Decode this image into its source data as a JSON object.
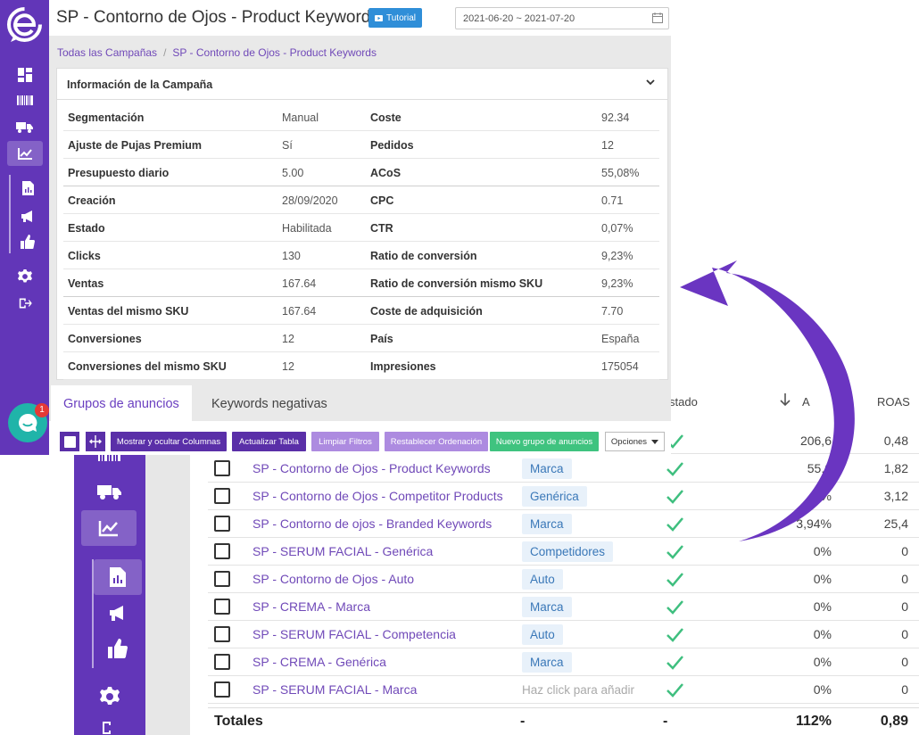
{
  "header": {
    "title": "SP - Contorno de Ojos - Product Keywords",
    "tutorial_label": "Tutorial",
    "date_range": "2021-06-20 ~ 2021-07-20"
  },
  "breadcrumb": {
    "root": "Todas las Campañas",
    "separator": "/",
    "current": "SP - Contorno de Ojos - Product Keywords"
  },
  "chat": {
    "badge_count": "1"
  },
  "campaign_info": {
    "title": "Información de la Campaña",
    "rows": [
      {
        "l1": "Segmentación",
        "v1": "Manual",
        "l2": "Coste",
        "v2": "92.34"
      },
      {
        "l1": "Ajuste de Pujas Premium",
        "v1": "Sí",
        "l2": "Pedidos",
        "v2": "12"
      },
      {
        "l1": "Presupuesto diario",
        "v1": "5.00",
        "l2": "ACoS",
        "v2": "55,08%"
      },
      {
        "l1": "Creación",
        "v1": "28/09/2020",
        "l2": "CPC",
        "v2": "0.71"
      },
      {
        "l1": "Estado",
        "v1": "Habilitada",
        "l2": "CTR",
        "v2": "0,07%"
      },
      {
        "l1": "Clicks",
        "v1": "130",
        "l2": "Ratio de conversión",
        "v2": "9,23%"
      },
      {
        "l1": "Ventas",
        "v1": "167.64",
        "l2": "Ratio de conversión mismo SKU",
        "v2": "9,23%"
      },
      {
        "l1": "Ventas del mismo SKU",
        "v1": "167.64",
        "l2": "Coste de adquisición",
        "v2": "7.70"
      },
      {
        "l1": "Conversiones",
        "v1": "12",
        "l2": "País",
        "v2": "España"
      },
      {
        "l1": "Conversiones del mismo SKU",
        "v1": "12",
        "l2": "Impresiones",
        "v2": "175054"
      }
    ]
  },
  "tabs": [
    "Grupos de anuncios",
    "Keywords negativas"
  ],
  "toolbar": {
    "show_hide_columns": "Mostrar y ocultar Columnas",
    "update_table": "Actualizar Tabla",
    "clear_filters": "Limpiar Filtros",
    "reset_order": "Restablecer Ordenación",
    "new_group": "Nuevo grupo de anuncios",
    "options": "Opciones"
  },
  "table": {
    "headers": {
      "estado": "stado",
      "acos_partial": "A",
      "roas": "ROAS"
    },
    "first_row": {
      "pct": "206,6",
      "roas": "0,48"
    },
    "rows": [
      {
        "name": "SP - Contorno de Ojos - Product Keywords",
        "tag": "Marca",
        "pct": "55,0",
        "roas": "1,82"
      },
      {
        "name": "SP - Contorno de Ojos - Competitor Products",
        "tag": "Genérica",
        "pct": "3  %",
        "roas": "3,12"
      },
      {
        "name": "SP - Contorno de ojos - Branded Keywords",
        "tag": "Marca",
        "pct": "3,94%",
        "roas": "25,4"
      },
      {
        "name": "SP - SERUM FACIAL - Genérica",
        "tag": "Competidores",
        "pct": "0%",
        "roas": "0"
      },
      {
        "name": "SP - Contorno de Ojos - Auto",
        "tag": "Auto",
        "pct": "0%",
        "roas": "0"
      },
      {
        "name": "SP - CREMA - Marca",
        "tag": "Marca",
        "pct": "0%",
        "roas": "0"
      },
      {
        "name": "SP - SERUM FACIAL - Competencia",
        "tag": "Auto",
        "pct": "0%",
        "roas": "0"
      },
      {
        "name": "SP - CREMA - Genérica",
        "tag": "Marca",
        "pct": "0%",
        "roas": "0"
      },
      {
        "name": "SP - SERUM FACIAL - Marca",
        "tag": "Haz click para añadir",
        "pct": "0%",
        "roas": "0"
      }
    ],
    "totals": {
      "label": "Totales",
      "tag": "-",
      "estado": "-",
      "pct": "112%",
      "roas": "0,89"
    }
  },
  "colors": {
    "sidebar": "#6236b8",
    "accent": "#7049b8",
    "arrow": "#6a35c1",
    "tutorial": "#2f8ed8",
    "new_group": "#3fc37f"
  },
  "icons": [
    "logo-icon",
    "dashboard-icon",
    "barcode-icon",
    "truck-icon",
    "chart-icon",
    "report-icon",
    "megaphone-icon",
    "thumbs-up-icon",
    "gear-icon",
    "logout-icon",
    "calendar-icon",
    "chevron-down-icon",
    "check-icon",
    "chat-icon",
    "sort-down-icon"
  ]
}
